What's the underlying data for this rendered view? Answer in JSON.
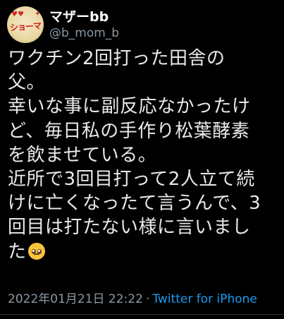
{
  "tweet": {
    "author": {
      "display_name": "マザーbb",
      "handle": "@b_mom_b",
      "avatar_text": "ショーマ",
      "avatar_icon": "avatar-logo"
    },
    "text_lines": [
      "ワクチン2回打った田舎の",
      "父。",
      "幸いな事に副反応なかったけ",
      "ど、毎日私の手作り松葉酵素",
      "を飲ませている。",
      "近所で3回目打って2人立て続",
      "けに亡くなったて言うんで、3",
      "回目は打たない様に言いまし",
      "た"
    ],
    "emoji": "pleading-face",
    "timestamp": "2022年01月21日 22:22",
    "separator": "·",
    "source": "Twitter for iPhone"
  },
  "colors": {
    "background": "#000000",
    "text": "#e7e9ea",
    "secondary": "#8b98a5",
    "link": "#1d9bf0"
  }
}
